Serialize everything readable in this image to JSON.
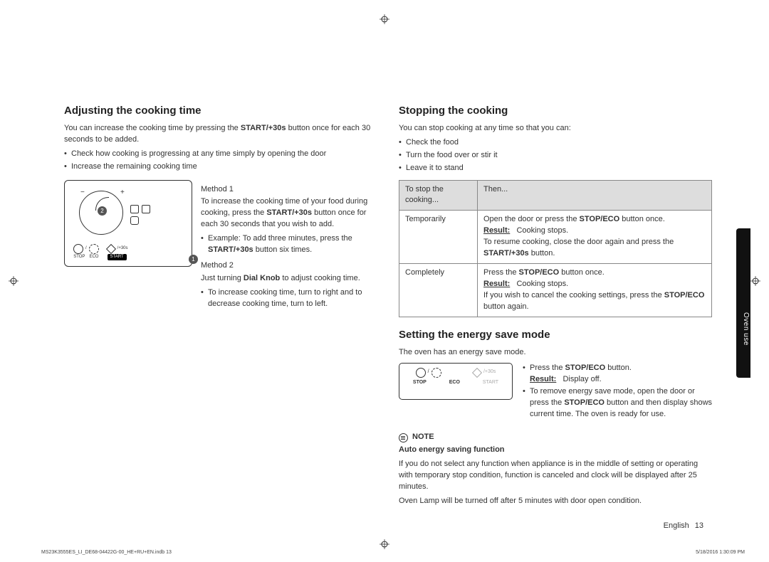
{
  "left": {
    "heading": "Adjusting the cooking time",
    "intro_a": "You can increase the cooking time by pressing the ",
    "intro_bold": "START/+30s",
    "intro_b": " button once for each 30 seconds to be added.",
    "bullets": [
      "Check how cooking is progressing at any time simply by opening the door",
      "Increase the remaining cooking time"
    ],
    "panel": {
      "minus": "−",
      "plus": "+",
      "badge1": "1",
      "badge2": "2",
      "stop": "STOP",
      "eco": "ECO",
      "start": "START",
      "plus30": "/+30s"
    },
    "m1h": "Method 1",
    "m1a": "To increase the cooking time of your food during cooking, press the ",
    "m1bold": "START/+30s",
    "m1b": " button once for each 30 seconds that you wish to add.",
    "m1ex_a": "Example: To add three minutes, press the ",
    "m1ex_bold": "START/+30s",
    "m1ex_b": " button six times.",
    "m2h": "Method 2",
    "m2a": "Just turning ",
    "m2bold": "Dial Knob",
    "m2b": " to adjust cooking time.",
    "m2bul": "To increase cooking time, turn to right and to decrease cooking time, turn to left."
  },
  "right": {
    "stop_heading": "Stopping the cooking",
    "stop_intro": "You can stop cooking at any time so that you can:",
    "stop_bullets": [
      "Check the food",
      "Turn the food over or stir it",
      "Leave it to stand"
    ],
    "th1": "To stop the cooking...",
    "th2": "Then...",
    "r1c1": "Temporarily",
    "r1_a": "Open the door or press the ",
    "r1_bold1": "STOP/ECO",
    "r1_b": " button once.",
    "r1_res_lbl": "Result:",
    "r1_res_txt": "Cooking stops.",
    "r1_c": "To resume cooking, close the door again and press the ",
    "r1_bold2": "START/+30s",
    "r1_d": " button.",
    "r2c1": "Completely",
    "r2_a": "Press the ",
    "r2_bold1": "STOP/ECO",
    "r2_b": " button once.",
    "r2_res_lbl": "Result:",
    "r2_res_txt": "Cooking stops.",
    "r2_c": "If you wish to cancel the cooking settings, press the ",
    "r2_bold2": "STOP/ECO",
    "r2_d": " button again.",
    "energy_heading": "Setting the energy save mode",
    "energy_intro": "The oven has an energy save mode.",
    "ef": {
      "stop": "STOP",
      "eco": "ECO",
      "start": "START",
      "plus30": "/+30s"
    },
    "e_b1a": "Press the ",
    "e_b1bold": "STOP/ECO",
    "e_b1b": " button.",
    "e_b1_res_lbl": "Result:",
    "e_b1_res_txt": "Display off.",
    "e_b2a": "To remove energy save mode, open the door or press the ",
    "e_b2bold": "STOP/ECO",
    "e_b2b": " button and then display shows current time. The oven is ready for use.",
    "note_lbl": "NOTE",
    "note_sub": "Auto energy saving function",
    "note_p1": "If you do not select any function when appliance is in the middle of setting or operating with temporary stop condition, function is canceled and clock will be displayed after 25 minutes.",
    "note_p2": "Oven Lamp will be turned off after 5 minutes with door open condition."
  },
  "side_tab": "Oven use",
  "footer": {
    "left": "MS23K3555ES_LI_DE68-04422G-00_HE+RU+EN.indb   13",
    "right": "5/18/2016   1:30:09 PM",
    "lang": "English",
    "page": "13"
  }
}
